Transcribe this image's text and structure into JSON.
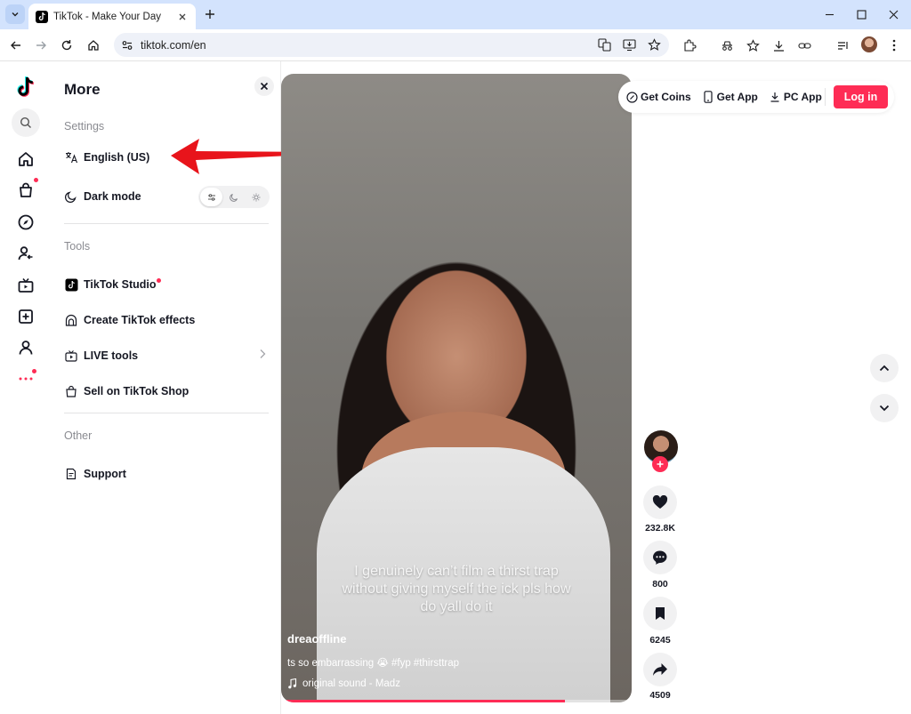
{
  "browser": {
    "tab_title": "TikTok - Make Your Day",
    "url": "tiktok.com/en"
  },
  "sidebar_rail": {
    "items": [
      "home-icon",
      "shop-icon",
      "explore-icon",
      "following-icon",
      "live-icon",
      "upload-icon",
      "profile-icon",
      "more-icon"
    ]
  },
  "more_panel": {
    "title": "More",
    "settings_label": "Settings",
    "language": "English (US)",
    "dark_mode": "Dark mode",
    "tools_label": "Tools",
    "tiktok_studio": "TikTok Studio",
    "create_effects": "Create TikTok effects",
    "live_tools": "LIVE tools",
    "sell_shop": "Sell on TikTok Shop",
    "other_label": "Other",
    "support": "Support"
  },
  "header": {
    "get_coins": "Get Coins",
    "get_app": "Get App",
    "pc_app": "PC App",
    "login": "Log in"
  },
  "video": {
    "caption": "I genuinely can’t film a thirst trap without giving myself the ick pls how do yall do it",
    "author": "dreaoffline",
    "description": "ts so embarrassing 😭 #fyp #thirsttrap",
    "sound": "original sound - Madz",
    "progress_fraction": 0.81
  },
  "actions": {
    "likes": "232.8K",
    "comments": "800",
    "saves": "6245",
    "shares": "4509"
  },
  "colors": {
    "brand": "#fe2c55",
    "tab_strip": "#d3e3fd",
    "annotation_arrow": "#e8141b"
  }
}
